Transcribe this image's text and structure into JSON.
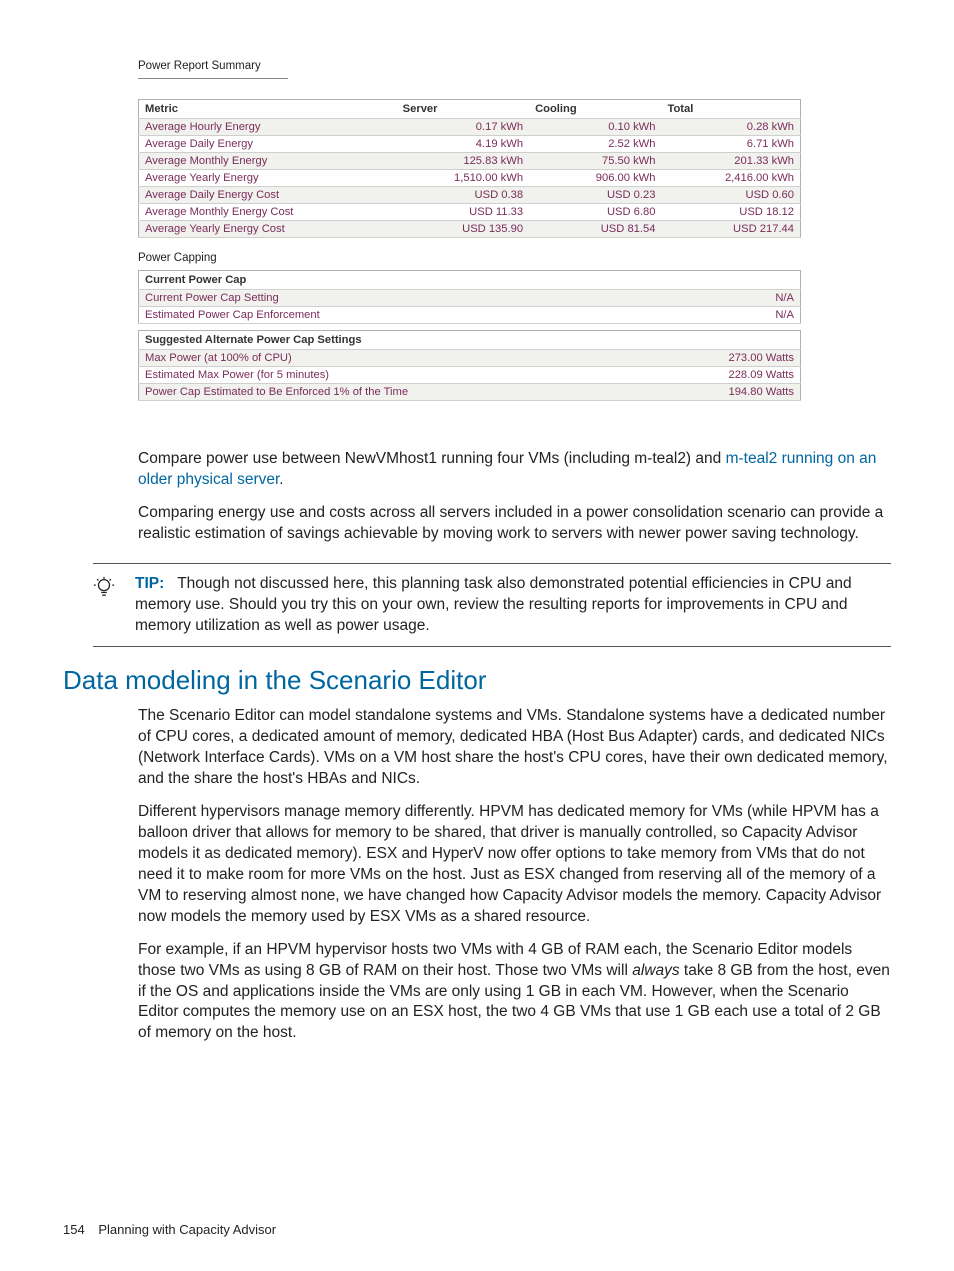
{
  "report": {
    "title": "Power Report Summary",
    "columns": {
      "metric": "Metric",
      "server": "Server",
      "cooling": "Cooling",
      "total": "Total"
    },
    "rows": [
      {
        "metric": "Average Hourly Energy",
        "server": "0.17 kWh",
        "cooling": "0.10 kWh",
        "total": "0.28 kWh"
      },
      {
        "metric": "Average Daily Energy",
        "server": "4.19 kWh",
        "cooling": "2.52 kWh",
        "total": "6.71 kWh"
      },
      {
        "metric": "Average Monthly Energy",
        "server": "125.83 kWh",
        "cooling": "75.50 kWh",
        "total": "201.33 kWh"
      },
      {
        "metric": "Average Yearly Energy",
        "server": "1,510.00 kWh",
        "cooling": "906.00 kWh",
        "total": "2,416.00 kWh"
      },
      {
        "metric": "Average Daily Energy Cost",
        "server": "USD 0.38",
        "cooling": "USD 0.23",
        "total": "USD 0.60"
      },
      {
        "metric": "Average Monthly Energy Cost",
        "server": "USD 11.33",
        "cooling": "USD 6.80",
        "total": "USD 18.12"
      },
      {
        "metric": "Average Yearly Energy Cost",
        "server": "USD 135.90",
        "cooling": "USD 81.54",
        "total": "USD 217.44"
      }
    ]
  },
  "capping": {
    "title": "Power Capping",
    "current_header": "Current Power Cap",
    "current_rows": [
      {
        "label": "Current Power Cap Setting",
        "value": "N/A"
      },
      {
        "label": "Estimated Power Cap Enforcement",
        "value": "N/A"
      }
    ],
    "suggested_header": "Suggested Alternate Power Cap Settings",
    "suggested_rows": [
      {
        "label": "Max Power (at 100% of CPU)",
        "value": "273.00 Watts"
      },
      {
        "label": "Estimated Max Power (for 5 minutes)",
        "value": "228.09 Watts"
      },
      {
        "label": "Power Cap Estimated to Be Enforced 1% of the Time",
        "value": "194.80 Watts"
      }
    ]
  },
  "body": {
    "p1_a": "Compare power use between NewVMhost1 running four VMs (including m-teal2) and ",
    "p1_link": "m-teal2 running on an older physical server",
    "p1_b": ".",
    "p2": "Comparing energy use and costs across all servers included in a power consolidation scenario can provide a realistic estimation of savings achievable by moving work to servers with newer power saving technology."
  },
  "tip": {
    "label": "TIP:",
    "text": "Though not discussed here, this planning task also demonstrated potential efficiencies in CPU and memory use. Should you try this on your own, review the resulting reports for improvements in CPU and memory utilization as well as power usage."
  },
  "section": {
    "heading": "Data modeling in the Scenario Editor",
    "p1": "The Scenario Editor can model standalone systems and VMs. Standalone systems have a dedicated number of CPU cores, a dedicated amount of memory, dedicated HBA (Host Bus Adapter) cards, and dedicated NICs (Network Interface Cards). VMs on a VM host share the host's CPU cores, have their own dedicated memory, and the share the host's HBAs and NICs.",
    "p2": "Different hypervisors manage memory differently. HPVM has dedicated memory for VMs (while HPVM has a balloon driver that allows for memory to be shared, that driver is manually controlled, so Capacity Advisor models it as dedicated memory). ESX and HyperV now offer options to take memory from VMs that do not need it to make room for more VMs on the host. Just as ESX changed from reserving all of the memory of a VM to reserving almost none, we have changed how Capacity Advisor models the memory. Capacity Advisor now models the memory used by ESX VMs as a shared resource.",
    "p3_a": "For example, if an HPVM hypervisor hosts two VMs with 4 GB of RAM each, the Scenario Editor models those two VMs as using 8 GB of RAM on their host. Those two VMs will ",
    "p3_em": "always",
    "p3_b": " take 8 GB from the host, even if the OS and applications inside the VMs are only using 1 GB in each VM. However, when the Scenario Editor computes the memory use on an ESX host, the two 4 GB VMs that use 1 GB each use a total of 2 GB of memory on the host."
  },
  "footer": {
    "page": "154",
    "chapter": "Planning with Capacity Advisor"
  }
}
